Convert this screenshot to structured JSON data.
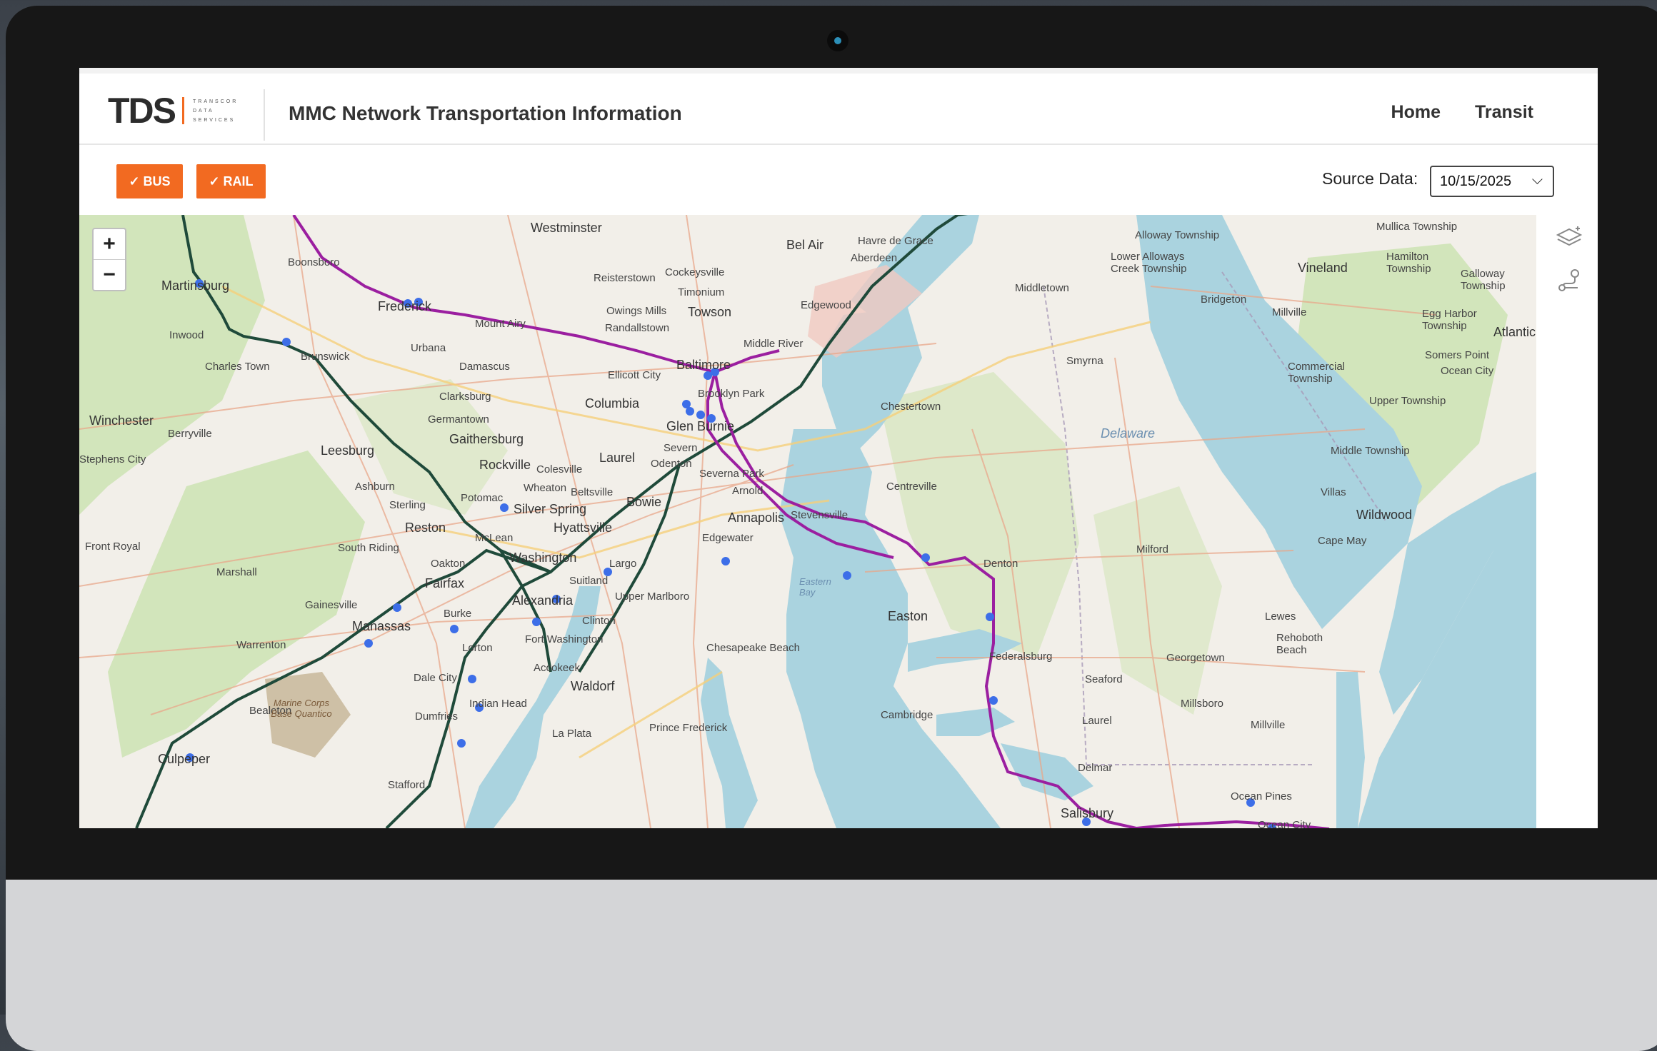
{
  "header": {
    "logo_text": "TDS",
    "logo_subtitle": [
      "TRANSCOR",
      "DATA",
      "SERVICES"
    ],
    "app_title": "MMC Network Transportation Information",
    "nav": [
      {
        "label": "Home"
      },
      {
        "label": "Transit"
      }
    ]
  },
  "filters": {
    "bus_label": "✓ BUS",
    "rail_label": "✓ RAIL"
  },
  "source": {
    "label": "Source Data:",
    "value": "10/15/2025"
  },
  "map": {
    "zoom_in": "+",
    "zoom_out": "−",
    "colors": {
      "water": "#aad3df",
      "land": "#f2efe9",
      "green": "#c8e0b0",
      "rail": "#1f4a3a",
      "bus": "#9b1fa0",
      "stop": "#3d6ee8"
    },
    "labels": [
      "Westminster",
      "Bel Air",
      "Havre de Grace",
      "Aberdeen",
      "Martinsburg",
      "Boonsboro",
      "Frederick",
      "Reisterstown",
      "Cockeysville",
      "Timonium",
      "Towson",
      "Owings Mills",
      "Randallstown",
      "Edgewood",
      "Middle River",
      "Baltimore",
      "Mount Airy",
      "Urbana",
      "Inwood",
      "Charles Town",
      "Brunswick",
      "Damascus",
      "Ellicott City",
      "Brooklyn Park",
      "Columbia",
      "Clarksburg",
      "Germantown",
      "Glen Burnie",
      "Gaithersburg",
      "Winchester",
      "Berryville",
      "Leesburg",
      "Rockville",
      "Colesville",
      "Laurel",
      "Severn",
      "Odenton",
      "Stephens City",
      "Severna Park",
      "Ashburn",
      "Wheaton",
      "Beltsville",
      "Potomac",
      "Arnold",
      "Sterling",
      "Silver Spring",
      "Bowie",
      "Reston",
      "Hyattsville",
      "Annapolis",
      "Stevensville",
      "Front Royal",
      "South Riding",
      "McLean",
      "Edgewater",
      "Oakton",
      "Washington",
      "Largo",
      "Marshall",
      "Fairfax",
      "Suitland",
      "Gainesville",
      "Burke",
      "Alexandria",
      "Upper Marlboro",
      "Manassas",
      "Clinton",
      "Warrenton",
      "Fort Washington",
      "Lorton",
      "Dale City",
      "Accokeek",
      "Chesapeake Beach",
      "Waldorf",
      "Bealeton",
      "Marine Corps Base Quantico",
      "Indian Head",
      "Dumfries",
      "La Plata",
      "Prince Frederick",
      "Culpeper",
      "Stafford",
      "Chestertown",
      "Centreville",
      "Easton",
      "Denton",
      "Middletown",
      "Smyrna",
      "Delaware",
      "Milford",
      "Federalsburg",
      "Seaford",
      "Georgetown",
      "Cambridge",
      "Laurel",
      "Millsboro",
      "Lewes",
      "Rehoboth Beach",
      "Millville",
      "Delmar",
      "Salisbury",
      "Ocean Pines",
      "Ocean City",
      "Alloway Township",
      "Lower Alloways Creek Township",
      "Vineland",
      "Bridgeton",
      "Millville",
      "Mullica Township",
      "Hamilton Township",
      "Galloway Township",
      "Egg Harbor Township",
      "Atlantic",
      "Somers Point",
      "Ocean City",
      "Commercial Township",
      "Upper Township",
      "Middle Township",
      "Villas",
      "Wildwood",
      "Cape May",
      "Eastern Bay"
    ]
  }
}
